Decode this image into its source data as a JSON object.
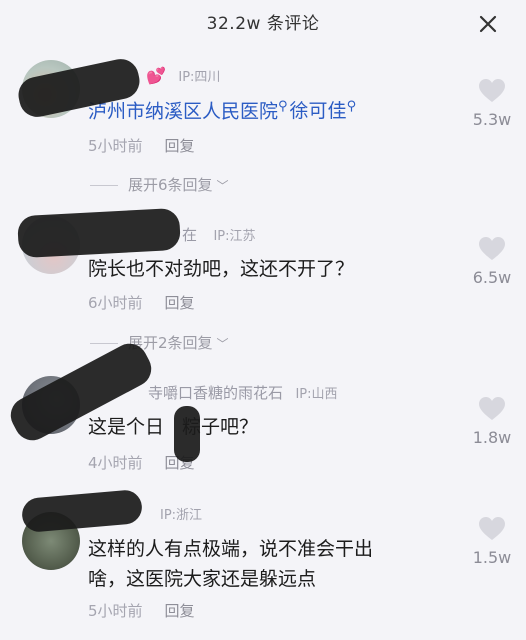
{
  "header": {
    "title": "32.2w 条评论",
    "close_icon": "close-icon"
  },
  "comments": [
    {
      "username_visible": "",
      "badge_icon": "heart-badge-icon",
      "ip": "IP:四川",
      "text_part1": "泸州市纳溪区人民医院",
      "text_part2": "徐可佳",
      "time": "5小时前",
      "reply": "回复",
      "expand": "展开6条回复",
      "likes": "5.3w"
    },
    {
      "username_visible": "在",
      "ip": "IP:江苏",
      "text": "院长也不对劲吧，这还不开了？",
      "time": "6小时前",
      "reply": "回复",
      "expand": "展开2条回复",
      "likes": "6.5w"
    },
    {
      "username_visible": "寺嚼口香糖的雨花石",
      "ip": "IP:山西",
      "text_a": "这是个日",
      "text_b": "粽子吧？",
      "time": "4小时前",
      "reply": "回复",
      "likes": "1.8w"
    },
    {
      "ip": "IP:浙江",
      "text_line1": "这样的人有点极端，说不准会干出",
      "text_line2": "啥，这医院大家还是躲远点",
      "time": "5小时前",
      "reply": "回复",
      "likes": "1.5w"
    }
  ]
}
